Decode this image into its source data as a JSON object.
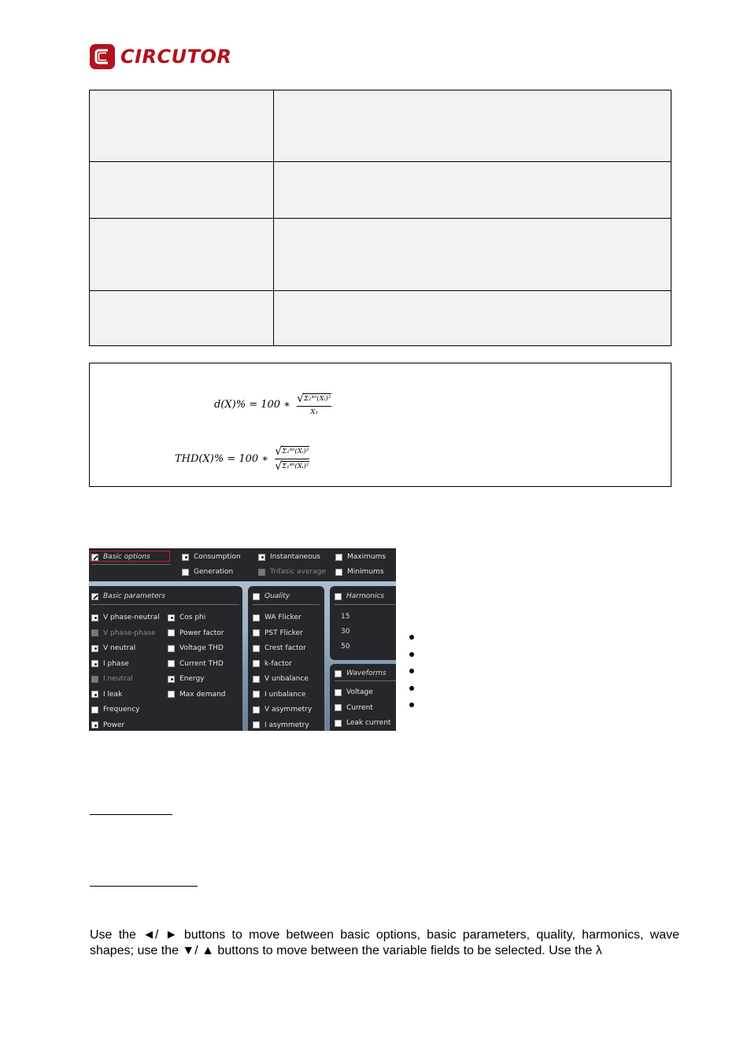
{
  "header": {
    "brand": "CIRCUTOR",
    "brand_color": "#b0121e"
  },
  "definition_table": {
    "rows": [
      {
        "term": "",
        "description": ""
      },
      {
        "term": "",
        "description": ""
      },
      {
        "term": "",
        "description": ""
      },
      {
        "term": "",
        "description": ""
      }
    ]
  },
  "formulas": {
    "distortion": {
      "lhs": "d(X)% = 100 ∗ ",
      "numerator": "Σ₂⁴⁰(Xᵢ)²",
      "denominator": "X₁"
    },
    "thd": {
      "lhs": "THD(X)% = 100 ∗ ",
      "numerator": "Σ₂⁴⁰(Xᵢ)²",
      "denominator": "Σ₁⁴⁰(Xᵢ)²"
    }
  },
  "device_screen": {
    "basic_options": {
      "title": "Basic options",
      "items": [
        {
          "label": "Consumption",
          "state": "checked"
        },
        {
          "label": "Generation",
          "state": "unchecked"
        },
        {
          "label": "Instantaneous",
          "state": "checked"
        },
        {
          "label": "Trifasic average",
          "state": "disabled"
        },
        {
          "label": "Maximums",
          "state": "unchecked"
        },
        {
          "label": "Minimums",
          "state": "unchecked"
        }
      ]
    },
    "basic_parameters": {
      "title": "Basic parameters",
      "col1": [
        {
          "label": "V phase-neutral",
          "state": "checked"
        },
        {
          "label": "V phase-phase",
          "state": "disabled"
        },
        {
          "label": "V neutral",
          "state": "checked"
        },
        {
          "label": "I phase",
          "state": "checked"
        },
        {
          "label": "I neutral",
          "state": "disabled"
        },
        {
          "label": "I leak",
          "state": "checked"
        },
        {
          "label": "Frequency",
          "state": "unchecked"
        },
        {
          "label": "Power",
          "state": "checked"
        }
      ],
      "col2": [
        {
          "label": "Cos phi",
          "state": "checked"
        },
        {
          "label": "Power factor",
          "state": "unchecked"
        },
        {
          "label": "Voltage THD",
          "state": "unchecked"
        },
        {
          "label": "Current THD",
          "state": "unchecked"
        },
        {
          "label": "Energy",
          "state": "checked"
        },
        {
          "label": "Max demand",
          "state": "unchecked"
        }
      ]
    },
    "quality": {
      "title": "Quality",
      "items": [
        {
          "label": "WA Flicker",
          "state": "unchecked"
        },
        {
          "label": "PST Flicker",
          "state": "unchecked"
        },
        {
          "label": "Crest factor",
          "state": "unchecked"
        },
        {
          "label": "k-factor",
          "state": "unchecked"
        },
        {
          "label": "V unbalance",
          "state": "unchecked"
        },
        {
          "label": "I unbalance",
          "state": "unchecked"
        },
        {
          "label": "V asymmetry",
          "state": "unchecked"
        },
        {
          "label": "I asymmetry",
          "state": "unchecked"
        }
      ]
    },
    "harmonics": {
      "title": "Harmonics",
      "values": [
        "15",
        "30",
        "50"
      ]
    },
    "waveforms": {
      "title": "Waveforms",
      "items": [
        {
          "label": "Voltage",
          "state": "unchecked"
        },
        {
          "label": "Current",
          "state": "unchecked"
        },
        {
          "label": "Leak current",
          "state": "unchecked"
        }
      ]
    },
    "selection_color": "#c0222e"
  },
  "bullets": [
    "",
    "",
    "",
    "",
    ""
  ],
  "body": {
    "paragraph": "Use the ◄/ ► buttons to move between basic options, basic parameters, quality, harmonics, wave shapes; use the ▼/ ▲ buttons to move between the variable fields to be selected. Use the λ"
  }
}
